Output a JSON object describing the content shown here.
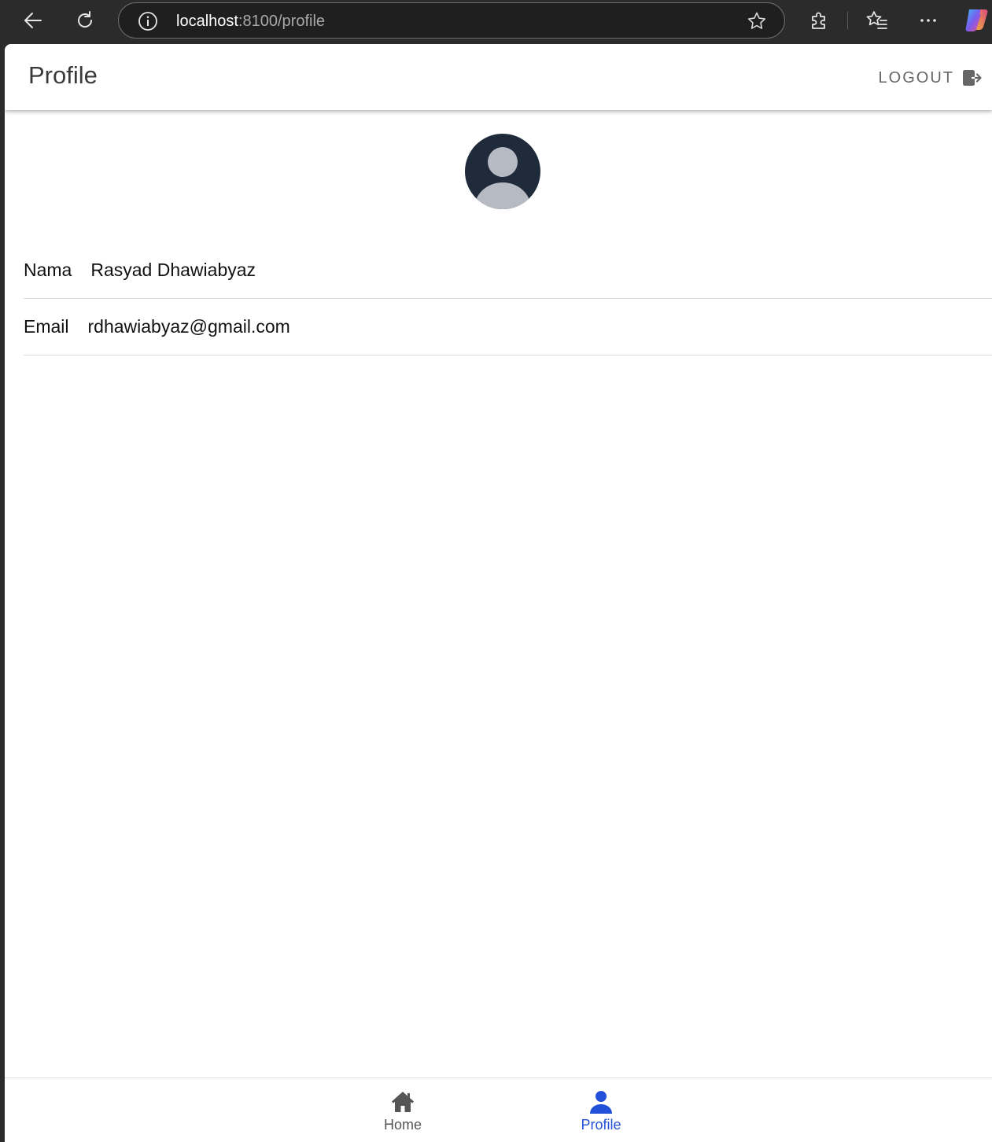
{
  "browser": {
    "url_host": "localhost",
    "url_rest": ":8100/profile"
  },
  "header": {
    "title": "Profile",
    "logout_label": "LOGOUT"
  },
  "profile": {
    "fields": [
      {
        "label": "Nama",
        "value": "Rasyad Dhawiabyaz"
      },
      {
        "label": "Email",
        "value": "rdhawiabyaz@gmail.com"
      }
    ]
  },
  "tabs": [
    {
      "label": "Home",
      "icon": "home-icon",
      "active": false
    },
    {
      "label": "Profile",
      "icon": "person-icon",
      "active": true
    }
  ],
  "colors": {
    "active_tab": "#2350d8",
    "inactive_tab": "#555555",
    "avatar_bg": "#1f2a3a",
    "avatar_figure": "#b6bac2"
  }
}
